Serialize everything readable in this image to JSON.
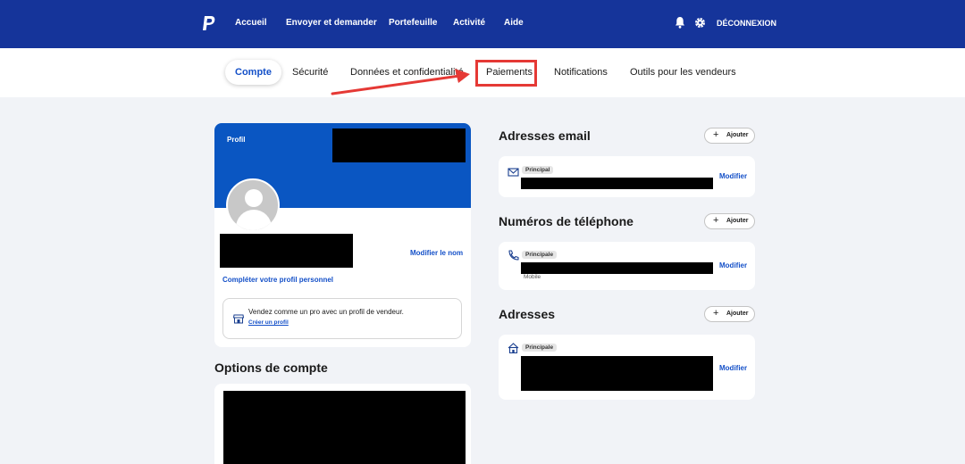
{
  "topnav": {
    "links": [
      "Accueil",
      "Envoyer et demander",
      "Portefeuille",
      "Activité",
      "Aide"
    ],
    "logout_label": "DÉCONNEXION",
    "colors": {
      "background": "#15349a",
      "text": "#ffffff"
    },
    "icons": [
      "paypal-logo",
      "bell-icon",
      "gear-icon"
    ]
  },
  "subnav": {
    "tabs": [
      "Compte",
      "Sécurité",
      "Données et confidentialité",
      "Paiements",
      "Notifications",
      "Outils pour les vendeurs"
    ],
    "active_tab": "Compte",
    "highlighted_tab": "Paiements",
    "annotation_color": "#e53935"
  },
  "profile": {
    "label": "Profil",
    "edit_name": "Modifier le nom",
    "complete_profile": "Compléter votre profil personnel",
    "seller_prompt": "Vendez comme un pro avec un profil de vendeur.",
    "seller_link": "Créer un profil",
    "banner_color": "#0a56c2"
  },
  "account_options": {
    "title": "Options de compte"
  },
  "email": {
    "title": "Adresses email",
    "add_label": "Ajouter",
    "badge": "Principal",
    "modify_label": "Modifier"
  },
  "phone": {
    "title": "Numéros de téléphone",
    "add_label": "Ajouter",
    "badge": "Principale",
    "type": "Mobile",
    "modify_label": "Modifier"
  },
  "address": {
    "title": "Adresses",
    "add_label": "Ajouter",
    "badge": "Principale",
    "modify_label": "Modifier"
  },
  "colors": {
    "link": "#1450c8",
    "page_background": "#f1f3f7"
  }
}
